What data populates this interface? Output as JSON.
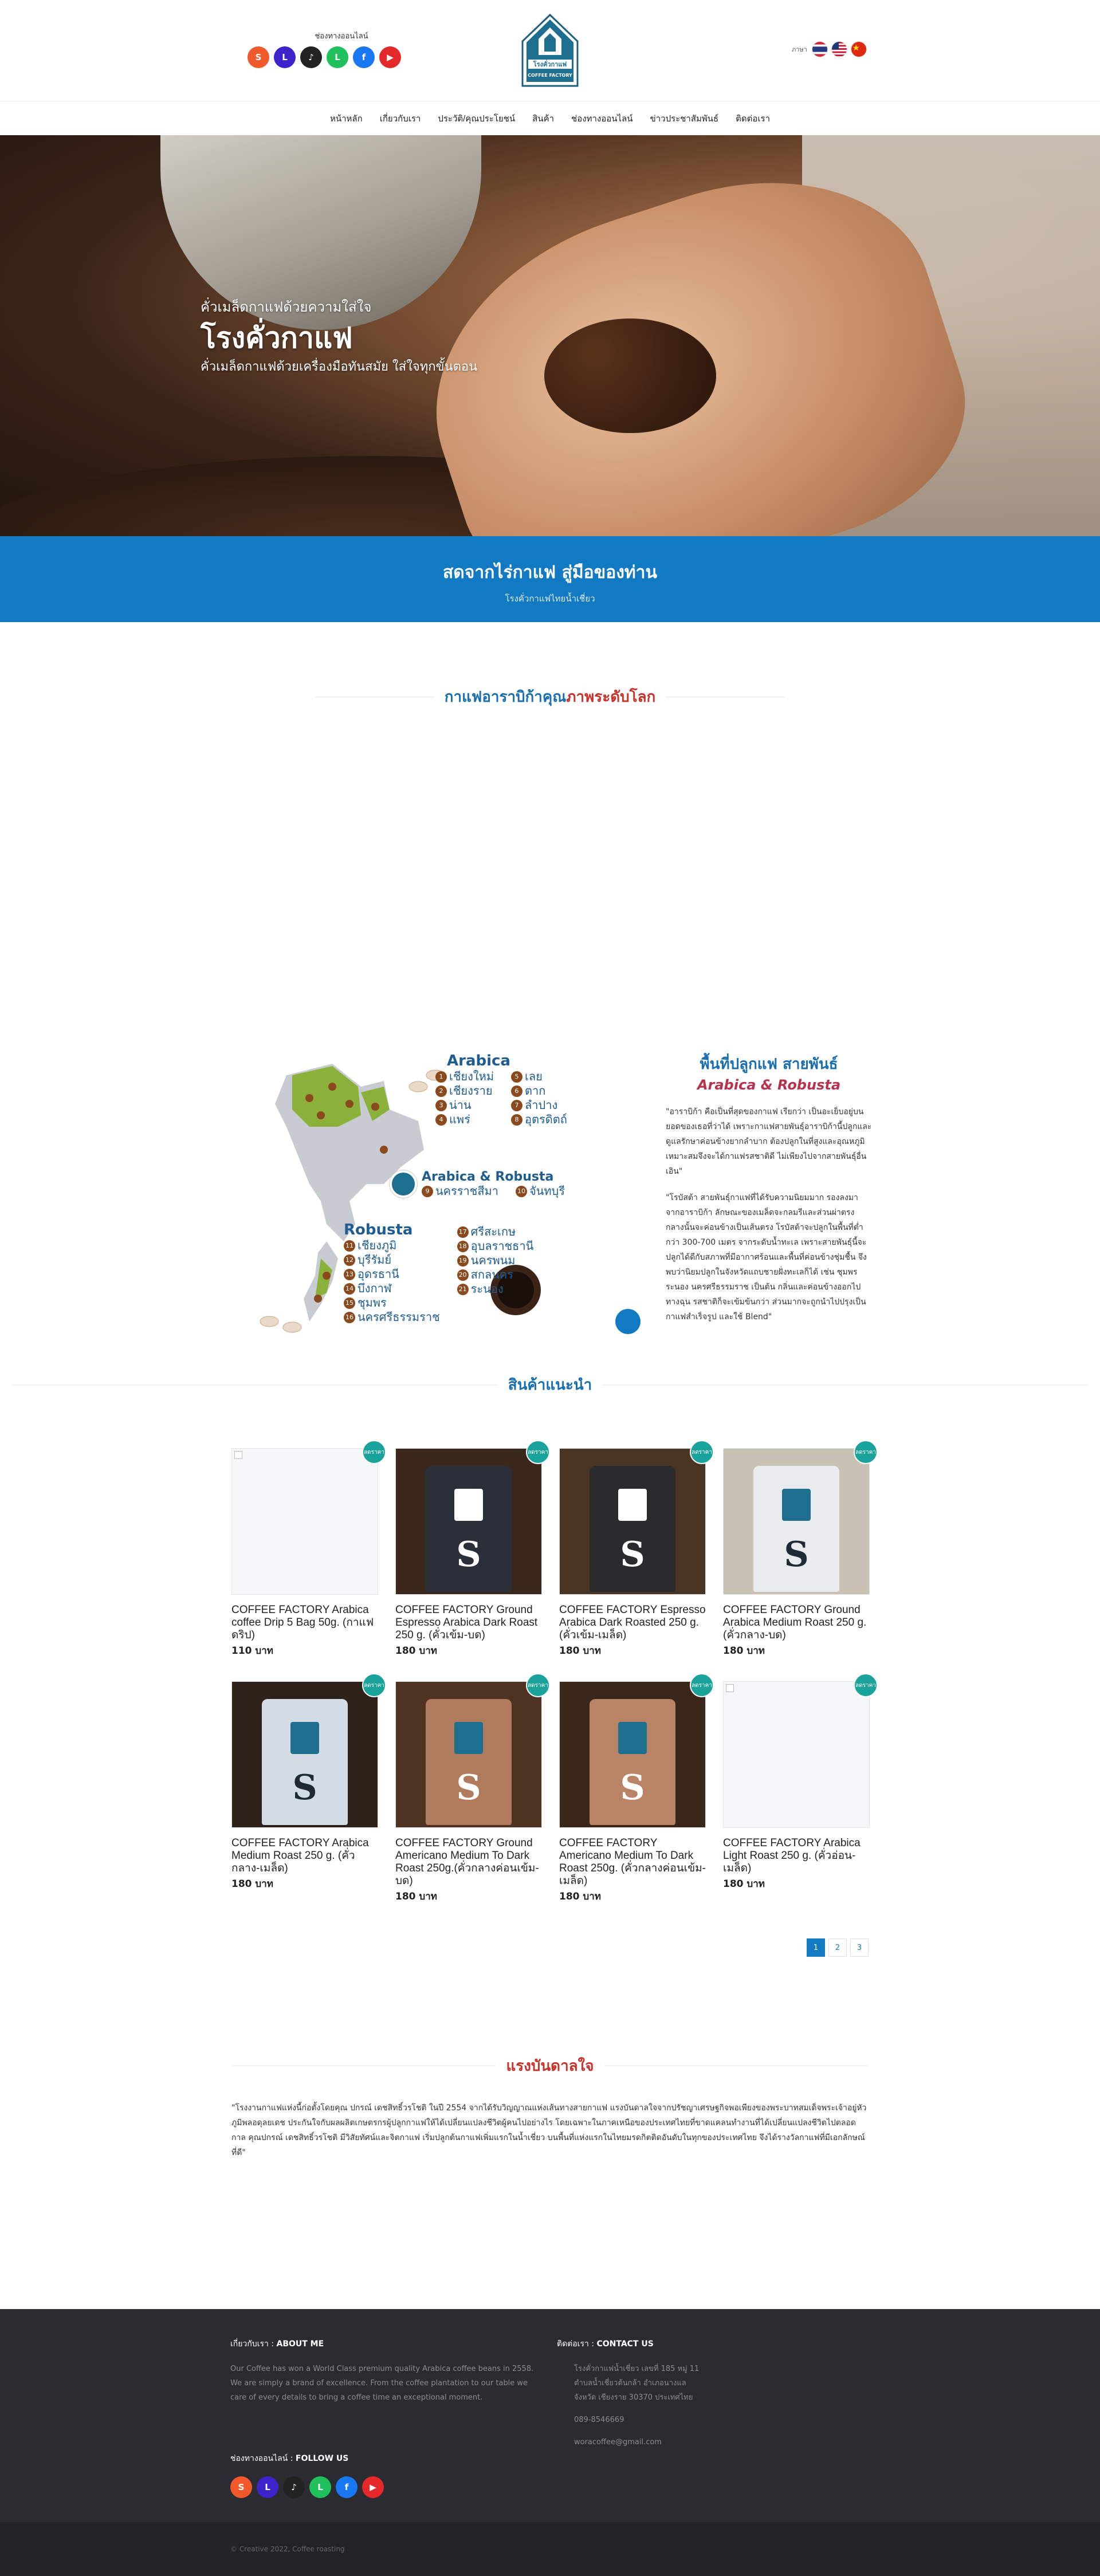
{
  "header": {
    "online_label": "ช่องทางออนไลน์",
    "lang_label": "ภาษา",
    "logo_text_th": "โรงคั่วกาแฟ",
    "logo_text_en": "COFFEE FACTORY"
  },
  "nav": [
    "หน้าหลัก",
    "เกี่ยวกับเรา",
    "ประวัติ/คุณประโยชน์",
    "สินค้า",
    "ช่องทางออนไลน์",
    "ข่าวประชาสัมพันธ์",
    "ติดต่อเรา"
  ],
  "hero": {
    "subtitle": "คั่วเมล็ดกาแฟด้วยความใส่ใจ",
    "title": "โรงคั่วกาแฟ",
    "description": "คั่วเมล็ดกาแฟด้วยเครื่องมือทันสมัย ใส่ใจทุกขั้นตอน"
  },
  "banner": {
    "title": "สดจากไร่กาแฟ สู่มือของท่าน",
    "subtitle": "โรงคั่วกาแฟไทยน้ำเชี่ยว"
  },
  "arabica_section": {
    "title_main": "กาแฟอาราบิก้าคุณ",
    "title_highlight": "ภาพระดับโลก"
  },
  "map": {
    "arabica_title": "Arabica",
    "arabica_left": [
      {
        "n": "1",
        "name": "เชียงใหม่"
      },
      {
        "n": "2",
        "name": "เชียงราย"
      },
      {
        "n": "3",
        "name": "น่าน"
      },
      {
        "n": "4",
        "name": "แพร่"
      }
    ],
    "arabica_right": [
      {
        "n": "5",
        "name": "เลย"
      },
      {
        "n": "6",
        "name": "ตาก"
      },
      {
        "n": "7",
        "name": "ลำปาง"
      },
      {
        "n": "8",
        "name": "อุตรดิตถ์"
      }
    ],
    "both_title": "Arabica & Robusta",
    "both_items": [
      {
        "n": "9",
        "name": "นครราชสีมา"
      },
      {
        "n": "10",
        "name": "จันทบุรี"
      }
    ],
    "robusta_title": "Robusta",
    "robusta_left": [
      {
        "n": "11",
        "name": "เชียงภูมิ"
      },
      {
        "n": "12",
        "name": "บุรีรัมย์"
      },
      {
        "n": "13",
        "name": "อุดรธานี"
      },
      {
        "n": "14",
        "name": "บึงกาฬ"
      },
      {
        "n": "15",
        "name": "ชุมพร"
      },
      {
        "n": "16",
        "name": "นครศรีธรรมราช"
      }
    ],
    "robusta_right": [
      {
        "n": "17",
        "name": "ศรีสะเกษ"
      },
      {
        "n": "18",
        "name": "อุบลราชธานี"
      },
      {
        "n": "19",
        "name": "นครพนม"
      },
      {
        "n": "20",
        "name": "สกลนคร"
      },
      {
        "n": "21",
        "name": "ระนอง"
      }
    ]
  },
  "area": {
    "title": "พื้นที่ปลูกแฟ สายพันธ์",
    "subtitle": "Arabica & Robusta",
    "para1": "\"อาราบิก้า คือเป็นที่สุดของกาแฟ เรียกว่า เป็นอะเย็บอยู่บนยอดของเธอที่ว่าได้ เพราะกาแฟสายพันธุ์อาราบิก้านี้ปลูกและดูแลรักษาค่อนข้างยากลำบาก ต้องปลูกในที่สูงและอุณหภูมิเหมาะสมจึงจะได้กาแฟรสชาติดี ไม่เพียงไปจากสายพันธุ์อื่นเอิน\"",
    "para2": "\"โรบัสต้า สายพันธุ์กาแฟที่ได้รับความนิยมมาก รองลงมาจากอาราบิก้า ลักษณะของเมล็ดจะกลมรีและส่วนผ่าตรงกลางนั้นจะค่อนข้างเป็นเส้นตรง โรบัสต้าจะปลูกในพื้นที่ต่ำกว่า 300-700 เมตร จากระดับน้ำทะเล เพราะสายพันธุ์นี้จะปลูกได้ดีกับสภาพที่มีอากาศร้อนและพื้นที่ค่อนข้างชุ่มชื้น จึงพบว่านิยมปลูกในจังหวัดแถบชายฝั่งทะเลก็ได้ เช่น ชุมพร ระนอง นครศรีธรรมราช เป็นต้น กลิ่นและค่อนข้างออกไปทางฉุน รสชาติก็จะเข้มข้นกว่า ส่วนมากจะถูกนำไปปรุงเป็นกาแฟสำเร็จรูป และใช้ Blend\""
  },
  "products_section": {
    "title": "สินค้าแนะนำ"
  },
  "products": [
    {
      "name": "COFFEE FACTORY Arabica coffee Drip 5 Bag 50g. (กาแฟดริป)",
      "price": "110 บาท",
      "badge": "ลดราคา",
      "bag": "none",
      "color": "#ffffff",
      "bg": "#f6f7f8"
    },
    {
      "name": "COFFEE FACTORY Ground Espresso Arabica Dark Roast 250 g. (คั่วเข้ม-บด)",
      "price": "180 บาท",
      "badge": "ลดราคา",
      "bag": "dark",
      "color": "#2b2f3a",
      "bg": "#3a2719"
    },
    {
      "name": "COFFEE FACTORY Espresso Arabica Dark Roasted 250 g. (คั่วเข้ม-เมล็ด)",
      "price": "180 บาท",
      "badge": "ลดราคา",
      "bag": "dark",
      "color": "#2b2b2e",
      "bg": "#4a3424"
    },
    {
      "name": "COFFEE FACTORY Ground Arabica Medium Roast 250 g. (คั่วกลาง-บด)",
      "price": "180 บาท",
      "badge": "ลดราคา",
      "bag": "light",
      "color": "#e9ecef",
      "bg": "#c9c1b3"
    },
    {
      "name": "COFFEE FACTORY Arabica Medium Roast 250 g. (คั่วกลาง-เมล็ด)",
      "price": "180 บาท",
      "badge": "ลดราคา",
      "bag": "light",
      "color": "#d3dce4",
      "bg": "#2e2119"
    },
    {
      "name": "COFFEE FACTORY Ground Americano Medium To Dark Roast 250g.(คั่วกลางค่อนเข้ม-บด)",
      "price": "180 บาท",
      "badge": "ลดราคา",
      "bag": "copper",
      "color": "#b07a5c",
      "bg": "#4e3322"
    },
    {
      "name": "COFFEE FACTORY Americano Medium To Dark Roast 250g. (คั่วกลางค่อนเข้ม-เมล็ด)",
      "price": "180 บาท",
      "badge": "ลดราคา",
      "bag": "copper",
      "color": "#b98466",
      "bg": "#3a271a"
    },
    {
      "name": "COFFEE FACTORY Arabica Light Roast 250 g. (คั่วอ่อน-เมล็ด)",
      "price": "180 บาท",
      "badge": "ลดราคา",
      "bag": "none",
      "color": "#ffffff",
      "bg": "#f6f7f8"
    }
  ],
  "pagination": [
    "1",
    "2",
    "3"
  ],
  "inspiration": {
    "title": "แรงบันดาลใจ",
    "text": "\"โรงงานกาแฟแห่งนี้ก่อตั้งโดยคุณ ปกรณ์ เดชสิทธิ์วรโชติ ในปี 2554 จากได้รับวิญญาณแห่งเส้นทางสายกาแฟ แรงบันดาลใจจากปรัชญาเศรษฐกิจพอเพียงของพระบาทสมเด็จพระเจ้าอยู่หัวภูมิพลอดุลยเดช ประกันใจกับผลผลิตเกษตรกรผู้ปลูกกาแฟให้ได้เปลี่ยนแปลงชีวิตผู้คนไปอย่างไร โดยเฉพาะในภาคเหนือของประเทศไทยที่ขาดแคลนทำงานที่ได้เปลี่ยนแปลงชีวิตไปตลอดกาล คุณปกรณ์ เดชสิทธิ์วรโชติ มีวิสัยทัศน์และจิตกาแฟ เริ่มปลูกต้นกาแฟเพิ่มแรกในน้ำเชี่ยว บนพื้นที่แห่งแรกในไทยมรดกิตติดอันดับในทุกของประเทศไทย จึงได้รางวัลกาแฟที่มีเอกลักษณ์ที่ดี\""
  },
  "footer": {
    "about_label": "เกี่ยวกับเรา : ",
    "about_title": "ABOUT ME",
    "about_text": "Our Coffee has won a World Class premium quality Arabica coffee beans in 2558. We are simply a brand of excellence. From the coffee plantation to our table we care of every details to bring a coffee time an exceptional moment.",
    "contact_label": "ติดต่อเรา : ",
    "contact_title": "CONTACT US",
    "address": "โรงคั่วกาแฟน้ำเชี่ยว เลขที่ 185 หมู่ 11 ตำบลน้ำเชี่ยวต้นกล้า อำเภอนางแล จังหวัด เชียงราย 30370 ประเทศไทย",
    "phone": "089-8546669",
    "email": "woracoffee@gmail.com",
    "follow_label": "ช่องทางออนไลน์ : ",
    "follow_title": "FOLLOW US",
    "copyright": "© Creative 2022, Coffee roasting"
  },
  "social_icons": [
    {
      "name": "shopee-icon",
      "glyph": "S",
      "color": "#f1592a"
    },
    {
      "name": "lazada-icon",
      "glyph": "L",
      "color": "#3b24c9"
    },
    {
      "name": "tiktok-icon",
      "glyph": "♪",
      "color": "#222222"
    },
    {
      "name": "line-icon",
      "glyph": "L",
      "color": "#20c05c"
    },
    {
      "name": "facebook-icon",
      "glyph": "f",
      "color": "#1877f2"
    },
    {
      "name": "youtube-icon",
      "glyph": "▶",
      "color": "#e5292b"
    }
  ]
}
